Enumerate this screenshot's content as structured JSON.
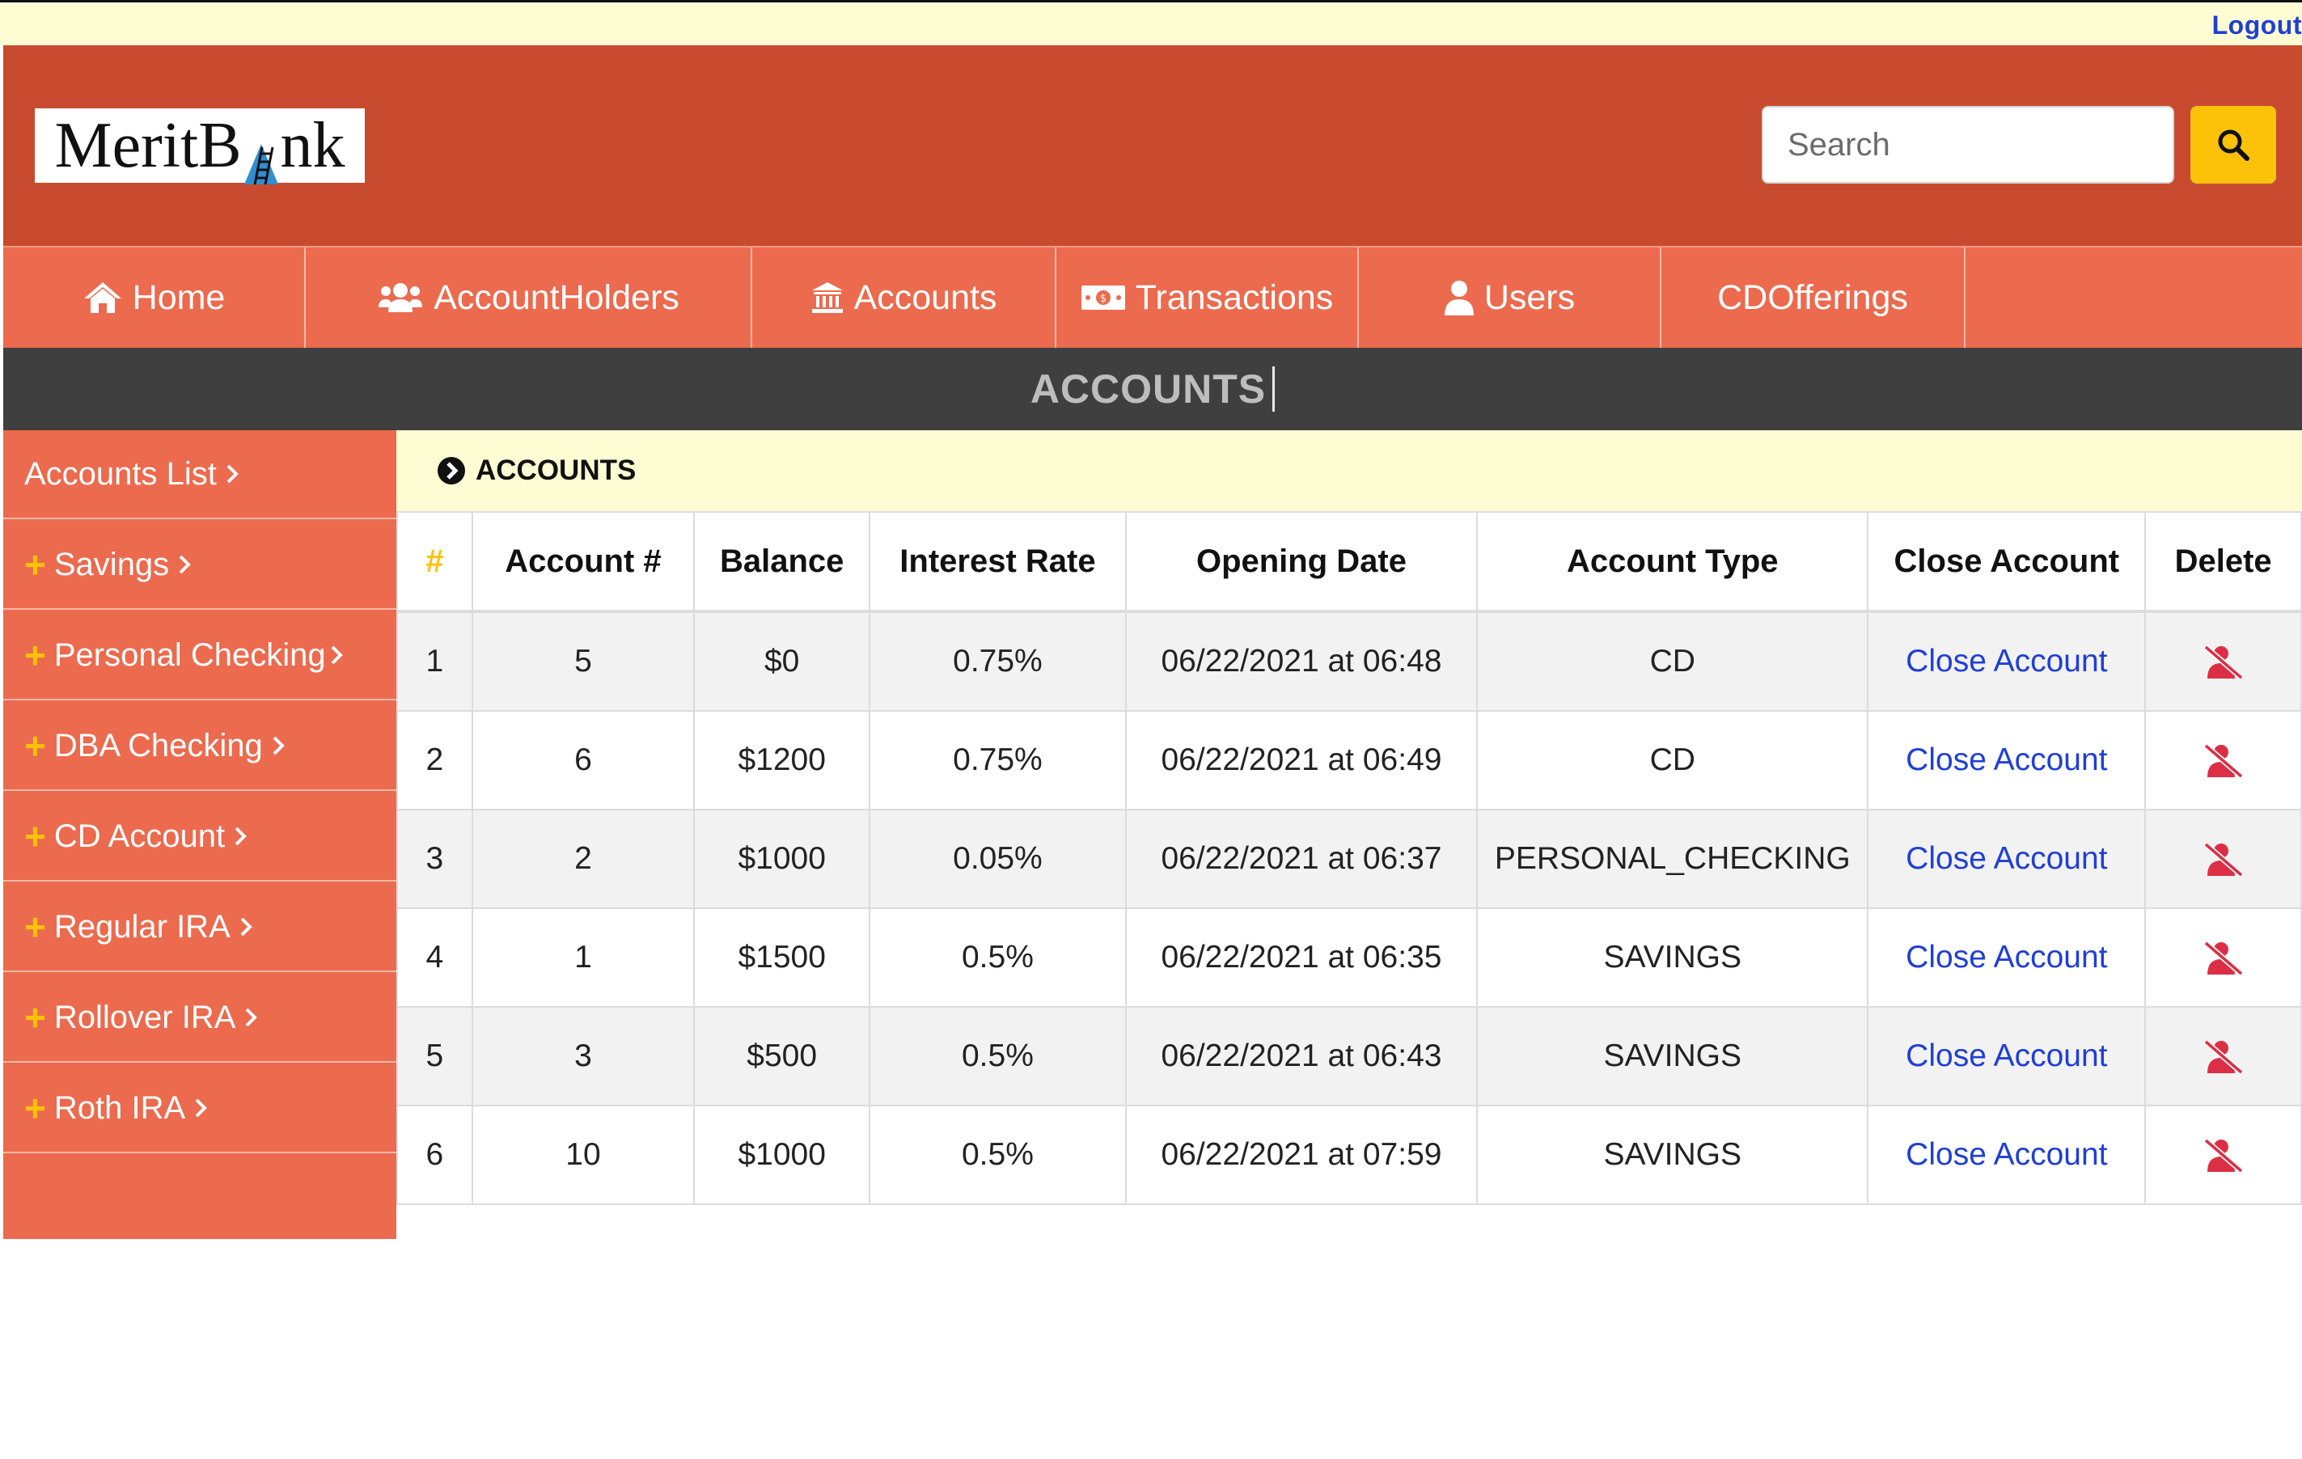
{
  "topbar": {
    "logout_label": "Logout"
  },
  "header": {
    "logo": {
      "part1": "MeritB",
      "part2": "nk"
    },
    "search": {
      "placeholder": "Search"
    },
    "colors": {
      "header_bg": "#c84b30",
      "nav_bg": "#ec6a4e",
      "accent_yellow": "#fcc20a",
      "link_blue": "#1f3fd6",
      "delete_red": "#dc2f45"
    }
  },
  "nav": {
    "items": [
      {
        "label": "Home",
        "icon": "home-icon"
      },
      {
        "label": "AccountHolders",
        "icon": "users-icon"
      },
      {
        "label": "Accounts",
        "icon": "bank-icon"
      },
      {
        "label": "Transactions",
        "icon": "money-bill-icon"
      },
      {
        "label": "Users",
        "icon": "user-icon"
      },
      {
        "label": "CDOfferings",
        "icon": ""
      }
    ]
  },
  "page_title": "ACCOUNTS",
  "sidebar": {
    "items": [
      {
        "label": "Accounts List",
        "has_plus": false
      },
      {
        "label": "Savings",
        "has_plus": true
      },
      {
        "label": "Personal Checking",
        "has_plus": true
      },
      {
        "label": "DBA Checking",
        "has_plus": true
      },
      {
        "label": "CD Account",
        "has_plus": true
      },
      {
        "label": "Regular IRA",
        "has_plus": true
      },
      {
        "label": "Rollover IRA",
        "has_plus": true
      },
      {
        "label": "Roth IRA",
        "has_plus": true
      }
    ]
  },
  "panel": {
    "heading": "ACCOUNTS"
  },
  "table": {
    "columns": [
      "#",
      "Account #",
      "Balance",
      "Interest Rate",
      "Opening Date",
      "Account Type",
      "Close Account",
      "Delete"
    ],
    "rows": [
      {
        "index": "1",
        "account": "5",
        "balance": "$0",
        "rate": "0.75%",
        "opened": "06/22/2021 at 06:48",
        "type": "CD",
        "close": "Close Account"
      },
      {
        "index": "2",
        "account": "6",
        "balance": "$1200",
        "rate": "0.75%",
        "opened": "06/22/2021 at 06:49",
        "type": "CD",
        "close": "Close Account"
      },
      {
        "index": "3",
        "account": "2",
        "balance": "$1000",
        "rate": "0.05%",
        "opened": "06/22/2021 at 06:37",
        "type": "PERSONAL_CHECKING",
        "close": "Close Account"
      },
      {
        "index": "4",
        "account": "1",
        "balance": "$1500",
        "rate": "0.5%",
        "opened": "06/22/2021 at 06:35",
        "type": "SAVINGS",
        "close": "Close Account"
      },
      {
        "index": "5",
        "account": "3",
        "balance": "$500",
        "rate": "0.5%",
        "opened": "06/22/2021 at 06:43",
        "type": "SAVINGS",
        "close": "Close Account"
      },
      {
        "index": "6",
        "account": "10",
        "balance": "$1000",
        "rate": "0.5%",
        "opened": "06/22/2021 at 07:59",
        "type": "SAVINGS",
        "close": "Close Account"
      }
    ]
  }
}
